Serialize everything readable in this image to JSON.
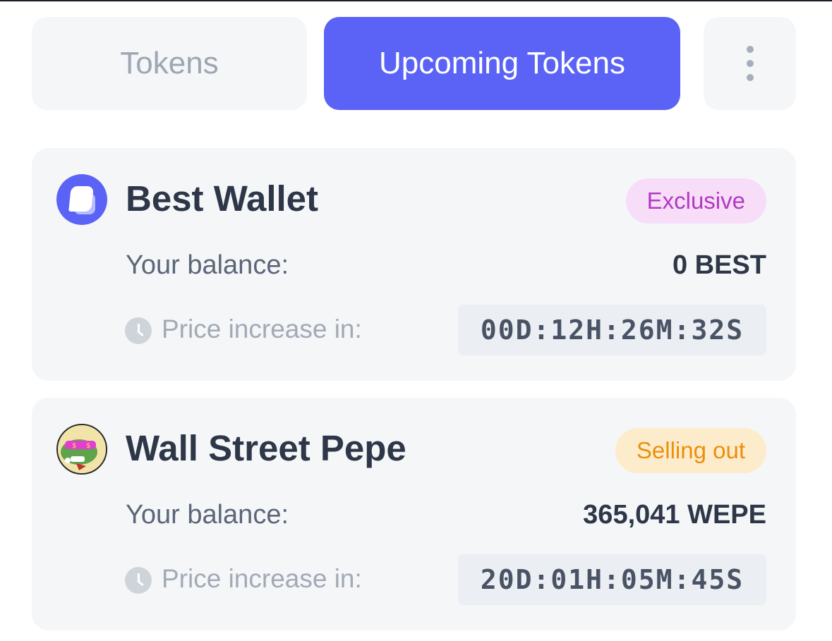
{
  "tabs": {
    "tokens_label": "Tokens",
    "upcoming_label": "Upcoming Tokens",
    "active": "Upcoming Tokens",
    "more_icon": "kebab-menu-icon"
  },
  "tokens": [
    {
      "name": "Best Wallet",
      "logo_icon": "best-wallet-logo",
      "badge": "Exclusive",
      "balance_label": "Your balance:",
      "balance_value": "0 BEST",
      "price_label": "Price increase in:",
      "timer": "00D:12H:26M:32S"
    },
    {
      "name": "Wall Street Pepe",
      "logo_icon": "wall-street-pepe-logo",
      "badge": "Selling out",
      "balance_label": "Your balance:",
      "balance_value": "365,041 WEPE",
      "price_label": "Price increase in:",
      "timer": "20D:01H:05M:45S"
    }
  ],
  "colors": {
    "accent": "#5b63f6",
    "card_bg": "#f4f6f8",
    "exclusive_bg": "#f7ddf8",
    "exclusive_text": "#b23ac2",
    "selling_bg": "#fdeccb",
    "selling_text": "#ec8f0b"
  }
}
